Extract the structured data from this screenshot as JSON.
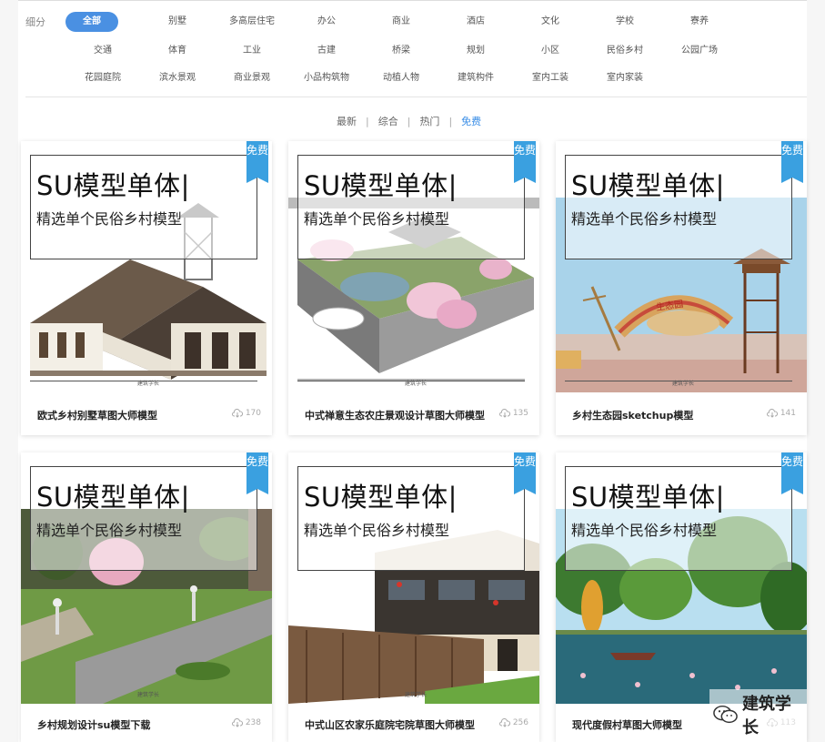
{
  "filters": {
    "label": "细分",
    "row1": [
      "全部",
      "别墅",
      "多高层住宅",
      "办公",
      "商业",
      "酒店",
      "文化",
      "学校",
      "寮养"
    ],
    "row2": [
      "交通",
      "体育",
      "工业",
      "古建",
      "桥梁",
      "规划",
      "小区",
      "民俗乡村",
      "公园广场"
    ],
    "row3": [
      "花园庭院",
      "滨水景观",
      "商业景观",
      "小品构筑物",
      "动植人物",
      "建筑构件",
      "室内工装",
      "室内家装"
    ],
    "active": "全部"
  },
  "sorts": [
    "最新",
    "综合",
    "热门",
    "免费"
  ],
  "sort_active": "免费",
  "overlay": {
    "title": "SU模型单体|",
    "subtitle": "精选单个民俗乡村模型"
  },
  "badge": "免费",
  "watermark": "建筑学长",
  "cards": [
    {
      "title": "欧式乡村别墅草图大师模型",
      "downloads": "170"
    },
    {
      "title": "中式禅意生态农庄景观设计草图大师模型",
      "downloads": "135"
    },
    {
      "title": "乡村生态园sketchup模型",
      "downloads": "141"
    },
    {
      "title": "乡村规划设计su模型下载",
      "downloads": "238"
    },
    {
      "title": "中式山区农家乐庭院宅院草图大师模型",
      "downloads": "256"
    },
    {
      "title": "现代度假村草图大师模型",
      "downloads": "113"
    }
  ],
  "scene3_sign": "生态园",
  "wechat_label": "建筑学长",
  "colors": {
    "accent": "#4a90e2",
    "badge": "#3aa0e0"
  }
}
